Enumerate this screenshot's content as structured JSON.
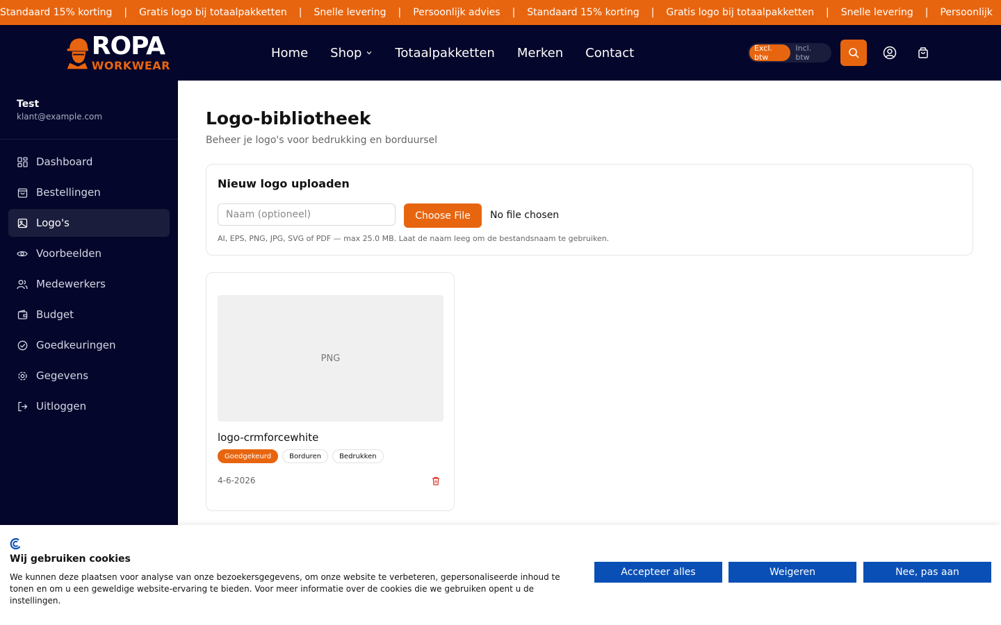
{
  "ticker": {
    "items": [
      "Standaard 15% korting",
      "Gratis logo bij totaalpakketten",
      "Snelle levering",
      "Persoonlijk advies",
      "Standaard 15% korting",
      "Gratis logo bij totaalpakketten",
      "Snelle levering",
      "Persoonlijk"
    ],
    "separator": "|"
  },
  "header": {
    "brand": {
      "top": "ROPA",
      "bottom": "WORKWEAR"
    },
    "nav": [
      {
        "label": "Home"
      },
      {
        "label": "Shop",
        "has_dropdown": true
      },
      {
        "label": "Totaalpakketten"
      },
      {
        "label": "Merken"
      },
      {
        "label": "Contact"
      }
    ],
    "vat": {
      "excl": "Excl. btw",
      "incl": "Incl. btw",
      "active": "excl"
    },
    "icons": [
      "search-icon",
      "user-icon",
      "cart-icon"
    ]
  },
  "sidebar": {
    "user_name": "Test",
    "user_email": "klant@example.com",
    "items": [
      {
        "label": "Dashboard",
        "icon": "dashboard-icon"
      },
      {
        "label": "Bestellingen",
        "icon": "bag-icon"
      },
      {
        "label": "Logo's",
        "icon": "image-icon",
        "active": true
      },
      {
        "label": "Voorbeelden",
        "icon": "eye-icon"
      },
      {
        "label": "Medewerkers",
        "icon": "users-icon"
      },
      {
        "label": "Budget",
        "icon": "wallet-icon"
      },
      {
        "label": "Goedkeuringen",
        "icon": "check-circle-icon"
      },
      {
        "label": "Gegevens",
        "icon": "gear-icon"
      },
      {
        "label": "Uitloggen",
        "icon": "logout-icon"
      }
    ]
  },
  "main": {
    "title": "Logo-bibliotheek",
    "subtitle": "Beheer je logo's voor bedrukking en borduursel",
    "upload": {
      "title": "Nieuw logo uploaden",
      "name_placeholder": "Naam (optioneel)",
      "name_value": "",
      "choose_label": "Choose File",
      "file_status": "No file chosen",
      "hint": "AI, EPS, PNG, JPG, SVG of PDF — max 25.0 MB. Laat de naam leeg om de bestandsnaam te gebruiken."
    },
    "logos": [
      {
        "format": "PNG",
        "name": "logo-crmforcewhite",
        "status": "Goedgekeurd",
        "tags": [
          "Borduren",
          "Bedrukken"
        ],
        "date": "4-6-2026"
      }
    ]
  },
  "cookie": {
    "title": "Wij gebruiken cookies",
    "text": "We kunnen deze plaatsen voor analyse van onze bezoekersgegevens, om onze website te verbeteren, gepersonaliseerde inhoud te tonen en om u een geweldige website-ervaring te bieden. Voor meer informatie over de cookies die we gebruiken opent u de instellingen.",
    "accept": "Accepteer alles",
    "reject": "Weigeren",
    "customize": "Nee, pas aan"
  },
  "colors": {
    "accent": "#e8650f",
    "navy": "#05062b",
    "cookie_button": "#0a4fb5"
  }
}
